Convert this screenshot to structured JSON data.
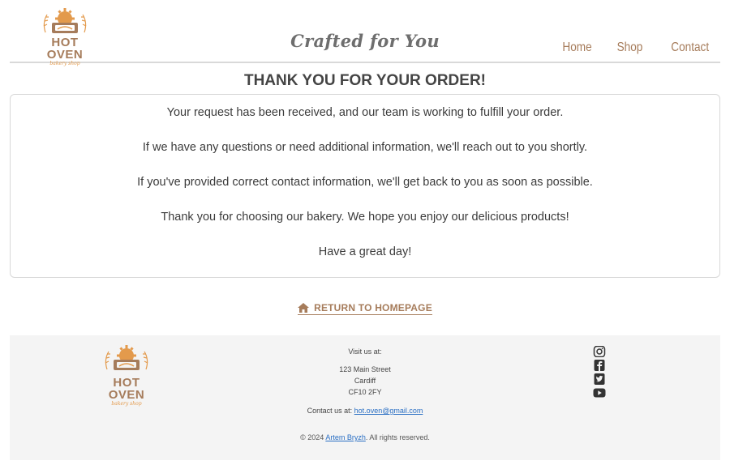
{
  "header": {
    "logo": {
      "name": "HOT OVEN",
      "sub": "bakery shop"
    },
    "tagline": "Crafted for You",
    "nav": [
      {
        "label": "Home"
      },
      {
        "label": "Shop"
      },
      {
        "label": "Contact"
      }
    ]
  },
  "main": {
    "title": "THANK YOU FOR YOUR ORDER!",
    "paragraphs": [
      "Your request has been received, and our team is working to fulfill your order.",
      "If we have any questions or need additional information, we'll reach out to you shortly.",
      "If you've provided correct contact information, we'll get back to you as soon as possible.",
      "Thank you for choosing our bakery. We hope you enjoy our delicious products!",
      "Have a great day!"
    ],
    "return_link": {
      "label": "RETURN TO HOMEPAGE",
      "icon": "home-icon"
    }
  },
  "footer": {
    "logo": {
      "name": "HOT OVEN",
      "sub": "bakery shop"
    },
    "visit_label": "Visit us at:",
    "address": [
      "123 Main Street",
      "Cardiff",
      "CF10 2FY"
    ],
    "contact_prefix": "Contact us at:",
    "contact_email": "hot.oven@gmail.com",
    "copyright_prefix": "© 2024",
    "copyright_author": "Artem Bryzh",
    "copyright_suffix": ". All rights reserved.",
    "social": [
      "instagram-icon",
      "facebook-icon",
      "twitter-icon",
      "youtube-icon"
    ]
  },
  "colors": {
    "brand_brown": "#a67c5b",
    "brand_orange": "#e39a4c",
    "link_blue": "#2a6fc4",
    "footer_bg": "#f4f4f4"
  }
}
